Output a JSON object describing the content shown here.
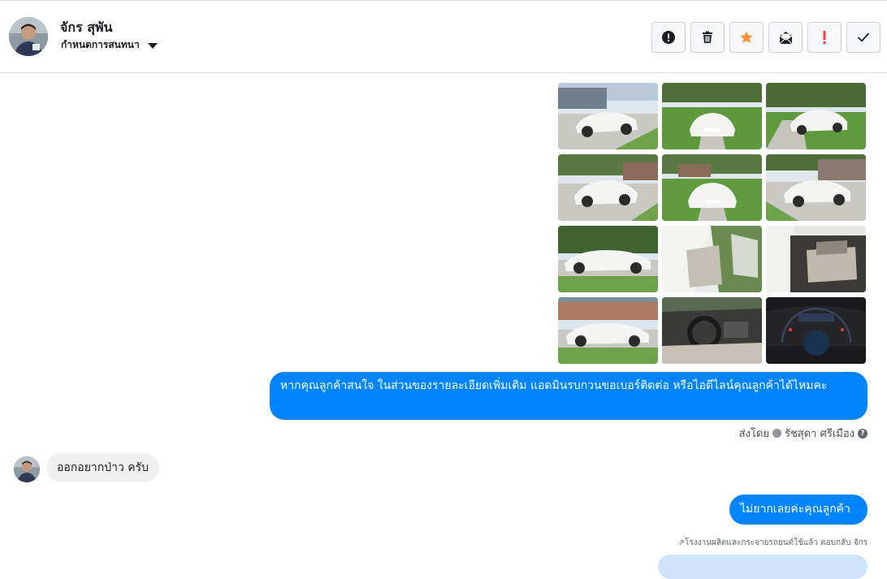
{
  "contact": {
    "name": "จักร สุพัน",
    "assign_label": "กำหนดการสนทนา"
  },
  "toolbar": {
    "buttons": [
      {
        "name": "spam-button",
        "icon": "alert-circle-icon",
        "color": "#1c1e21"
      },
      {
        "name": "delete-button",
        "icon": "trash-icon",
        "color": "#1c1e21"
      },
      {
        "name": "star-button",
        "icon": "star-icon",
        "color": "#f7923b"
      },
      {
        "name": "mark-unread-button",
        "icon": "envelope-icon",
        "color": "#1c1e21"
      },
      {
        "name": "follow-up-button",
        "icon": "exclamation-icon",
        "color": "#fa3e3e"
      },
      {
        "name": "done-button",
        "icon": "check-icon",
        "color": "#1c1e21"
      }
    ]
  },
  "photos": [
    {
      "label": "car-front-three-quarter"
    },
    {
      "label": "car-front"
    },
    {
      "label": "car-front-right"
    },
    {
      "label": "car-rear-left"
    },
    {
      "label": "car-rear"
    },
    {
      "label": "car-rear-right"
    },
    {
      "label": "car-side"
    },
    {
      "label": "car-front-door-open"
    },
    {
      "label": "car-rear-door-open"
    },
    {
      "label": "car-side-2"
    },
    {
      "label": "car-dashboard"
    },
    {
      "label": "car-gauges"
    }
  ],
  "messages": {
    "outgoing_1": "หากคุณลูกค้าสนใจ ในส่วนของรายละเอียดเพิ่มเติม แอดมินรบกวนขอเบอร์ติดต่อ หรือไอดีไลน์คุณลูกค้าได้ไหมคะ",
    "sent_by_label": "ส่งโดย",
    "sent_by_name": "รัชสุดา ศรีเมือง",
    "incoming_1": "ออกอยากป่าว ครับ",
    "outgoing_2": "ไม่ยากเลยค่ะคุณลูกค้า",
    "reply_note": "โรงงานผลิตและกระจายรถยนต์ใช้แล้ว ตอบกลับ จักร"
  },
  "colors": {
    "accent": "#0084ff",
    "star": "#f7923b",
    "flag": "#fa3e3e",
    "incoming_bubble": "#f1f0f0"
  }
}
